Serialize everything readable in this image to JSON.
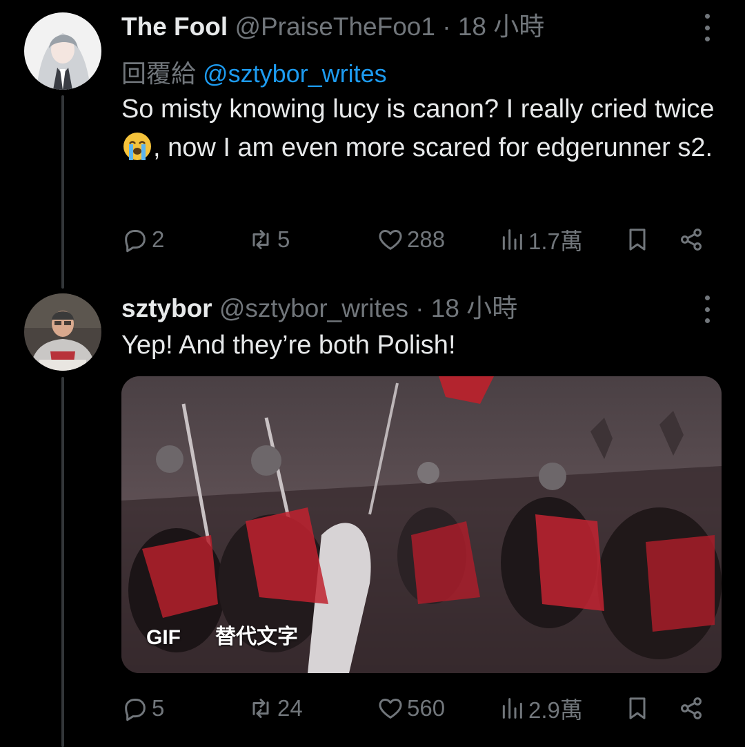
{
  "tweets": [
    {
      "name": "The Fool",
      "handle": "@PraiseTheFoo1",
      "separator": "·",
      "time": "18 小時",
      "reply_label": "回覆給",
      "reply_mention": "@sztybor_writes",
      "text_part1": "So misty knowing lucy is canon? I really cried twice",
      "emoji": "loudly-crying-face",
      "text_part2": ", now I am even more scared for edgerunner s2.",
      "replies": "2",
      "reposts": "5",
      "likes": "288",
      "views": "1.7萬"
    },
    {
      "name": "sztybor",
      "handle": "@sztybor_writes",
      "separator": "·",
      "time": "18 小時",
      "text": "Yep! And they’re both Polish!",
      "media": {
        "type_badge": "GIF",
        "alt_badge": "替代文字"
      },
      "replies": "5",
      "reposts": "24",
      "likes": "560",
      "views": "2.9萬"
    }
  ],
  "icons": {
    "reply": "reply-icon",
    "repost": "repost-icon",
    "like": "heart-icon",
    "views": "views-icon",
    "bookmark": "bookmark-icon",
    "share": "share-icon",
    "more": "more-icon"
  },
  "colors": {
    "background": "#000000",
    "text": "#e7e9ea",
    "muted": "#71767b",
    "link": "#1d9bf0"
  }
}
